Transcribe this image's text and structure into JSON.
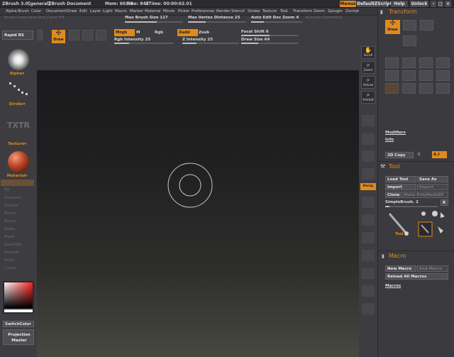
{
  "titlebar": {
    "app": "ZBrush 3.0[general]",
    "document": "ZBrush Document",
    "mem": "Mem: 60.98",
    "free": "Free: 842",
    "ztime": "ZTime: 00:00:02.01",
    "buttons": {
      "menus": "Menus",
      "default_script": "DefaultZScript",
      "help": "Help",
      "unlock": "Unlock"
    }
  },
  "menubar": [
    "Alpha",
    "Brush",
    "Color",
    "Document",
    "Draw",
    "Edit",
    "Layer",
    "Light",
    "Macro",
    "Marker",
    "Material",
    "Movie",
    "Picker",
    "Preferences",
    "Render",
    "Stencil",
    "Stroke",
    "Texture",
    "Tool",
    "Transform",
    "Zoom",
    "Zplugin",
    "Zscript"
  ],
  "shelf": {
    "max_brush_size": "Max Brush Size 117",
    "max_vertex_distance": "Max Vertex Distance 25",
    "auto_edit_doc_zoom": "Auto Edit Doc Zoom 4",
    "draw_label": "Draw",
    "mrgb": "Mrgb",
    "m": "M",
    "rgb": "Rgb",
    "zadd": "Zadd",
    "zsub": "Zsub",
    "focal_shift": "Focal Shift 0",
    "rgb_intensity": "Rgb Intensity 25",
    "z_intensity": "Z Intensity 25",
    "draw_size": "Draw Size 64",
    "faded_left": "Brush Load Save Proj Clone Fill",
    "faded_right": "Activate Symmetry",
    "sliders": {
      "max_brush_size": 0.55,
      "max_vertex_distance": 0.3,
      "auto_edit_doc_zoom": 0.25,
      "focal_shift": 0.5,
      "rgb_intensity": 0.25,
      "z_intensity": 0.25,
      "draw_size": 0.3
    }
  },
  "left_palette": {
    "rapid_rs": "Rapid RS",
    "alpha": "Alpha",
    "stroke": "Stroke",
    "texture_logo": "TXTR",
    "texture": "Texture",
    "material": "Material",
    "dim_items": [
      "Fill",
      "Gradient",
      "Outline",
      "Polish",
      "Bump",
      "Noise",
      "Mask",
      "SavePoly",
      "Smooth",
      "Pinch",
      "Cavity"
    ],
    "switch_color": "SwitchColor",
    "projection_master": "Projection Master"
  },
  "right_tools": {
    "scroll": "Scroll",
    "zoom": "Zoom",
    "actual": "Actual",
    "aahalf": "AAHalf",
    "persp": "Persp"
  },
  "right_panel": {
    "transform_title": "Transform",
    "draw": "Draw",
    "modifiers": "Modifiers",
    "info": "Info",
    "copy_3d": "3D Copy",
    "copy_3d_value": "0",
    "ai": "A.I",
    "tool_title": "Tool",
    "load_tool": "Load Tool",
    "save_as": "Save As",
    "import": "Import",
    "export": "Export",
    "clone": "Clone",
    "make_polymesh": "Make PolyMesh3D",
    "simple_brush": "SimpleBrush. 2",
    "r": "R",
    "tool_name": "Tool",
    "macro_title": "Macro",
    "new_macro": "New Macro",
    "end_macro": "End Macro",
    "reload_all_macros": "Reload All Macros",
    "macros": "Macros"
  },
  "colors": {
    "accent": "#e08a1e",
    "panel": "#3b3b3f",
    "canvas_top": "#1a1a1c",
    "canvas_bottom": "#484841"
  }
}
